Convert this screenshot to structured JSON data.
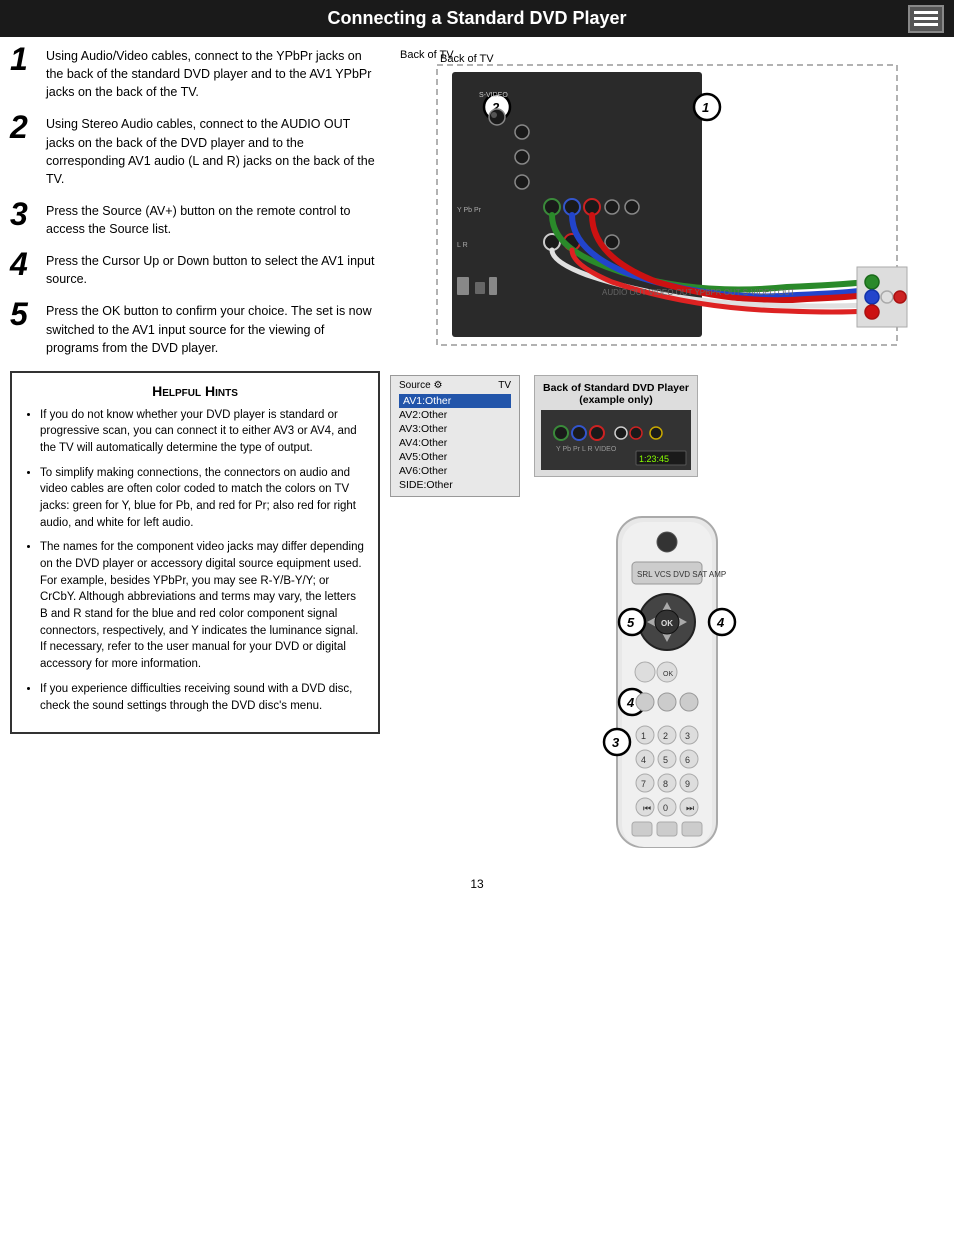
{
  "header": {
    "title": "Connecting a Standard DVD Player",
    "icon_label": "menu-icon"
  },
  "steps": [
    {
      "number": "1",
      "text": "Using Audio/Video cables, connect to the YPbPr jacks on the back of the standard DVD player and to the AV1 YPbPr jacks on the back of the TV."
    },
    {
      "number": "2",
      "text": "Using Stereo Audio cables, connect to the AUDIO OUT jacks on the back of the DVD player and to the corresponding AV1 audio (L and R) jacks on the back of the TV."
    },
    {
      "number": "3",
      "text": "Press the Source (AV+) button on the remote control to access the Source list."
    },
    {
      "number": "4",
      "text": "Press the Cursor Up or Down button to select the AV1 input source."
    },
    {
      "number": "5",
      "text": "Press the OK button to confirm your choice. The set is now switched to the AV1 input source for the viewing of programs from the DVD player."
    }
  ],
  "hints": {
    "title": "Helpful Hints",
    "items": [
      "If you do not know whether your DVD player is standard or progressive scan, you can connect it to either AV3 or AV4, and the TV will automatically determine the type of output.",
      "To simplify making connections, the connectors on audio and video cables are often color coded to match the colors on TV jacks: green for Y, blue for Pb, and red for Pr; also red for right audio, and white for left audio.",
      "The names for the component video jacks may differ depending on the DVD player or accessory digital source equipment used. For example, besides YPbPr, you may see R-Y/B-Y/Y; or CrCbY. Although abbreviations and terms may vary, the letters B and R stand for the blue and red color component signal connectors, respectively, and Y indicates the luminance signal. If necessary, refer to the user manual for your DVD or digital accessory for more information.",
      "If you experience difficulties receiving sound with a DVD disc, check the sound settings through the DVD disc's menu."
    ]
  },
  "labels": {
    "back_of_tv": "Back of TV",
    "back_of_dvd": "Back of Standard DVD Player\n(example only)",
    "source_menu_title": "TV",
    "source_label": "Source",
    "menu_items": [
      {
        "label": "AV1:Other",
        "selected": true
      },
      {
        "label": "AV2:Other",
        "selected": false
      },
      {
        "label": "AV3:Other",
        "selected": false
      },
      {
        "label": "AV4:Other",
        "selected": false
      },
      {
        "label": "AV5:Other",
        "selected": false
      },
      {
        "label": "AV6:Other",
        "selected": false
      },
      {
        "label": "SIDE:Other",
        "selected": false
      }
    ]
  },
  "page_number": "13",
  "italic_letters": {
    "B": "B",
    "R": "R",
    "Y": "Y"
  }
}
